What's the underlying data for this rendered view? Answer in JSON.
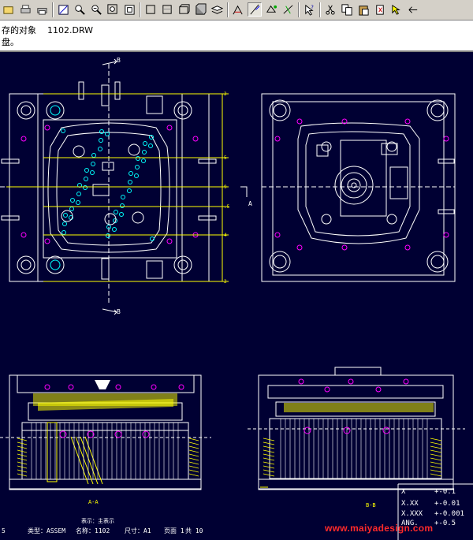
{
  "toolbar": {
    "groups": [
      [
        "open-file",
        "print",
        "print-setup"
      ],
      [
        "repaint",
        "zoom-in",
        "zoom-out",
        "zoom-window",
        "refit"
      ],
      [
        "wireframe",
        "hidden-line",
        "no-hidden",
        "shading",
        "layers"
      ],
      [
        "draft-edit",
        "draft-line",
        "datum-plane",
        "datum-axis"
      ],
      [
        "help-pointer"
      ],
      [
        "cut",
        "copy",
        "paste",
        "delete",
        "select",
        "undo-arrow"
      ]
    ]
  },
  "message": {
    "line1": "存的对象    1102.DRW",
    "line2": "盘。"
  },
  "drawing": {
    "section_marker": "B",
    "view_a_marker": "A",
    "dims": [
      "2",
      " 5",
      "",
      "9",
      ".5",
      "4",
      "2"
    ],
    "section_a_label": "A-A",
    "section_b_label": "B-B",
    "title_row1": "表示：主表示",
    "title_row2": [
      "类型：ASSEM",
      "名称：1102",
      "尺寸：A1",
      "页面 1",
      "共 10"
    ],
    "left_fragment": "5",
    "tolerances": [
      {
        "fmt": "X",
        "tol": "+-0.1"
      },
      {
        "fmt": "X.XX",
        "tol": "+-0.01"
      },
      {
        "fmt": "X.XXX",
        "tol": "+-0.001"
      },
      {
        "fmt": "ANG.",
        "tol": "+-0.5"
      }
    ]
  },
  "watermark": "www.maiyadesign.com",
  "colors": {
    "background": "#000033",
    "linework": "#ffffff",
    "dimension": "#ffff00",
    "pins": "#ff00ff",
    "holes": "#00ffff",
    "marker_blue": "#0000ff",
    "watermark": "#ff2a2a"
  }
}
